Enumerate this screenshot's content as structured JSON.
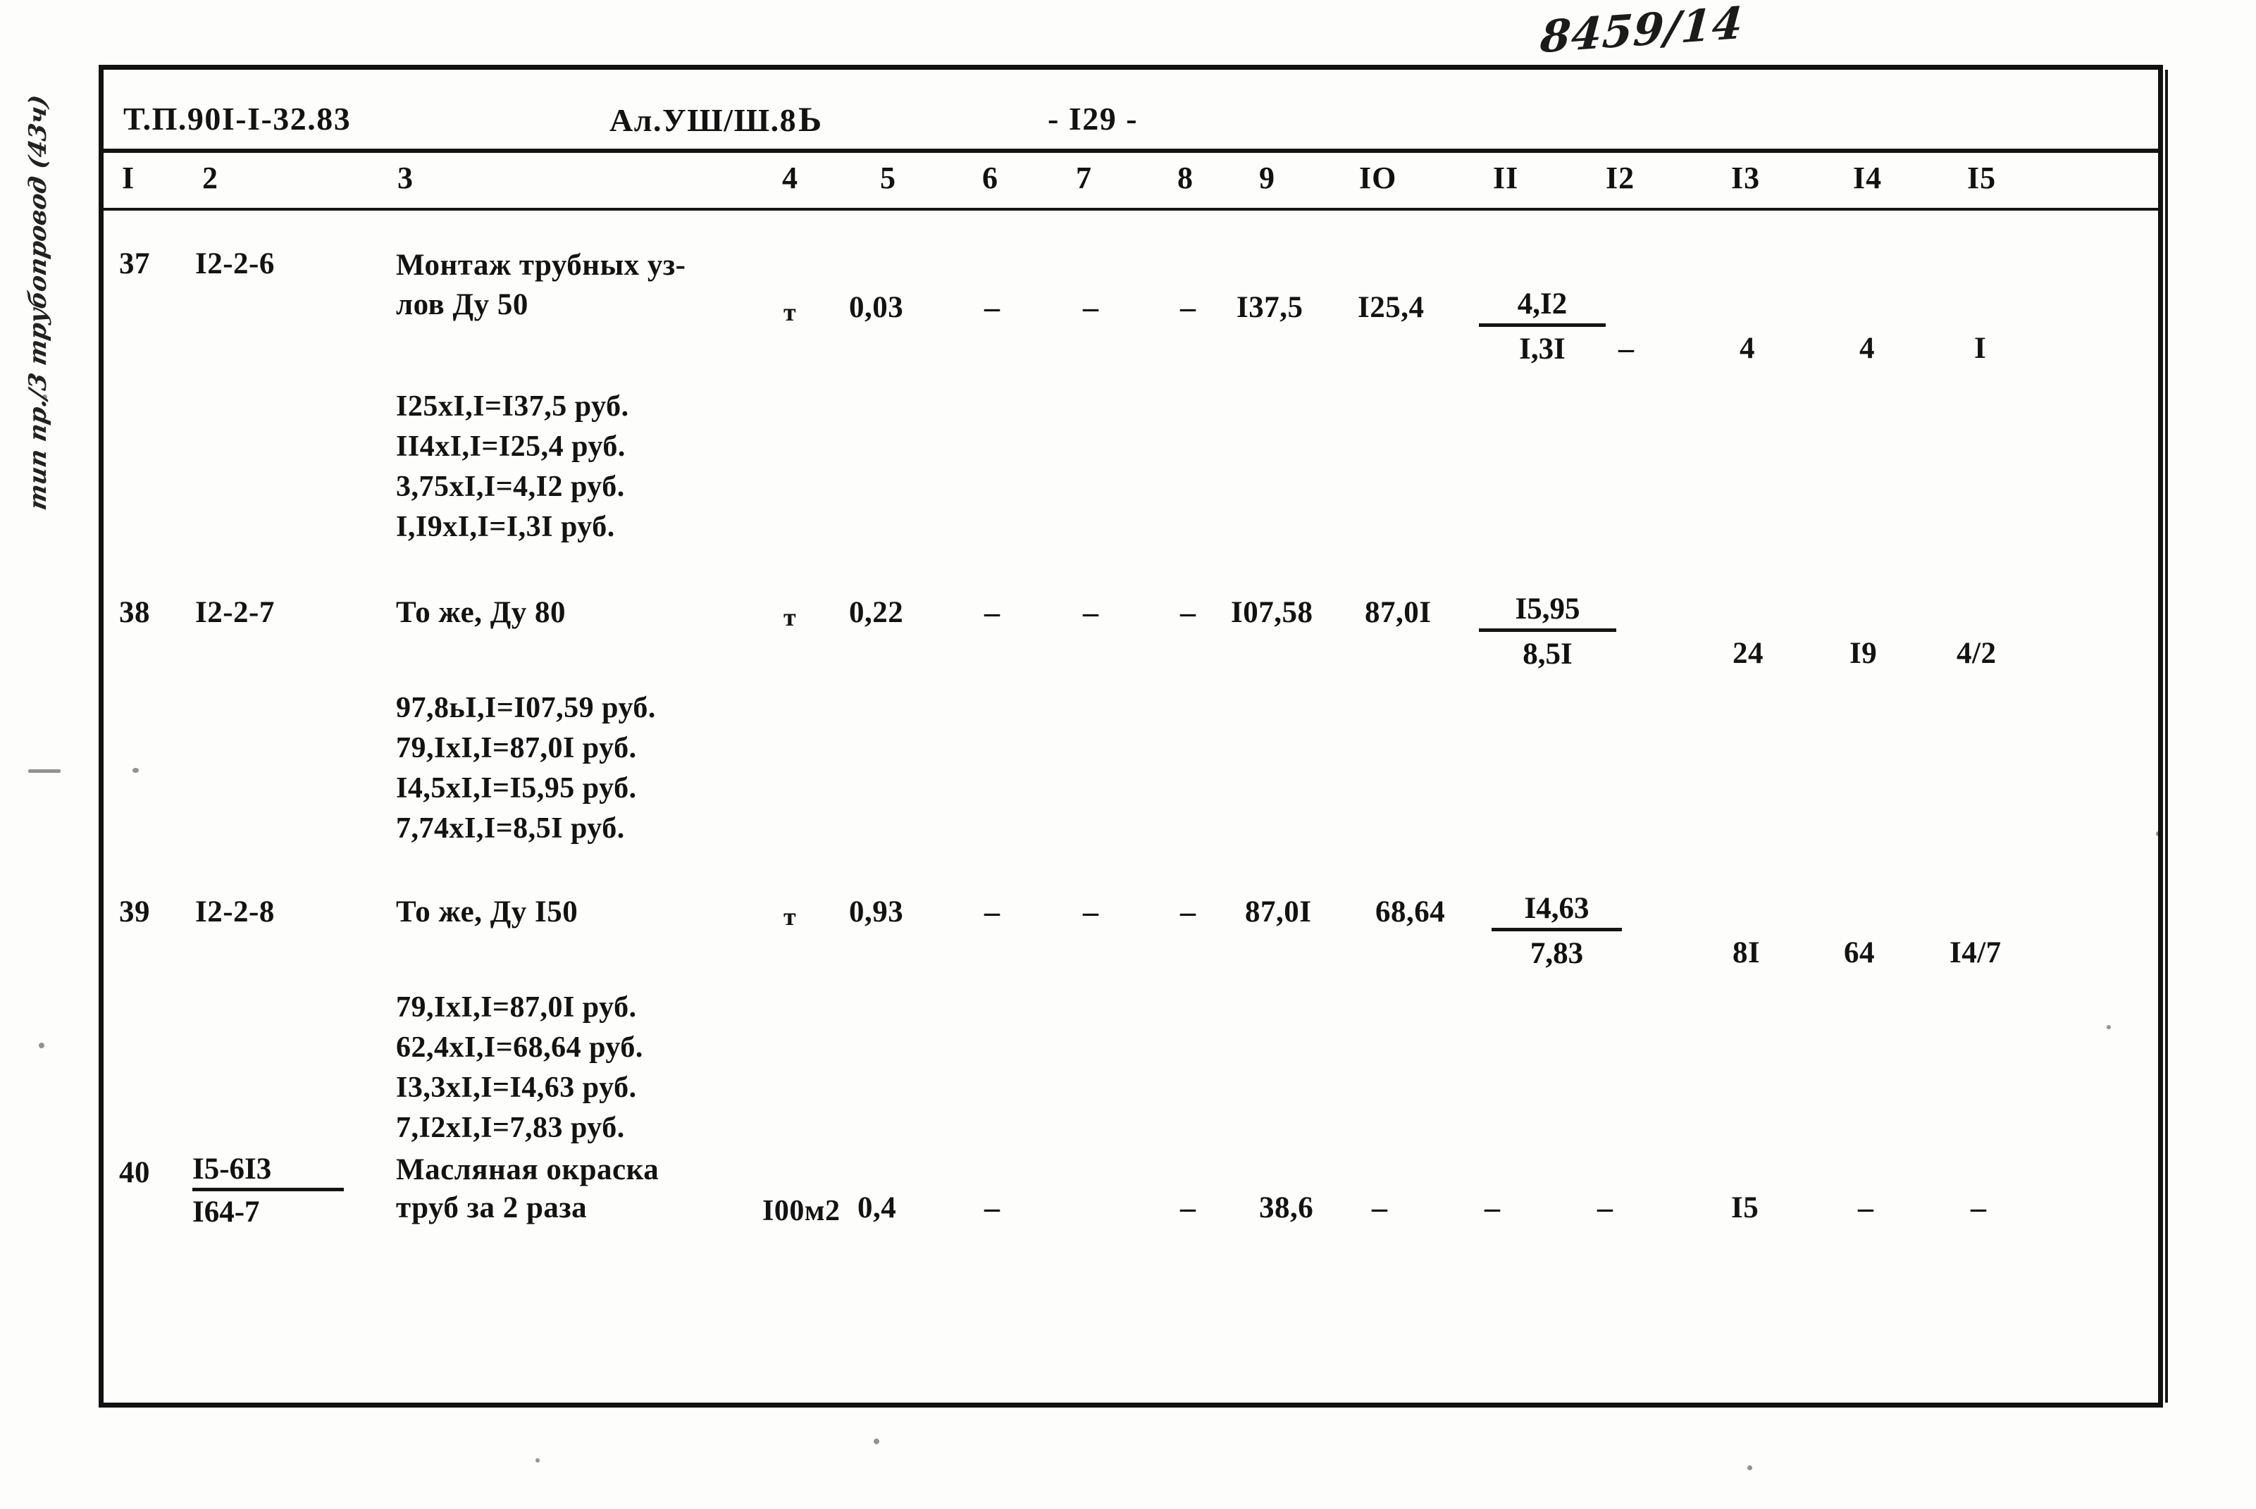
{
  "archive": {
    "handwritten_number": "8459/14",
    "margin_note": "тип пр./3 трубопровод (43ч)"
  },
  "header": {
    "document_code": "Т.П.90I-I-32.83",
    "album": "Ал.УШ/Ш.8",
    "album_stamp": "Ь",
    "page": "- I29 -"
  },
  "column_numbers": [
    "I",
    "2",
    "3",
    "4",
    "5",
    "6",
    "7",
    "8",
    "9",
    "IO",
    "II",
    "I2",
    "I3",
    "I4",
    "I5"
  ],
  "rows": [
    {
      "n": "37",
      "code": "I2-2-6",
      "description_line1": "Монтаж трубных уз-",
      "description_line2": "лов Ду 50",
      "unit": "т",
      "qty": "0,03",
      "c6": "–",
      "c7": "–",
      "c8": "–",
      "c9": "I37,5",
      "c10": "I25,4",
      "c11_num": "4,I2",
      "c11_den": "I,3I",
      "c12": "–",
      "c13": "4",
      "c14": "4",
      "c15": "I",
      "subs": [
        "I25xI,I=I37,5 руб.",
        "II4xI,I=I25,4 руб.",
        "3,75xI,I=4,I2 руб.",
        "I,I9xI,I=I,3I руб."
      ]
    },
    {
      "n": "38",
      "code": "I2-2-7",
      "description_line1": "То же, Ду 80",
      "description_line2": "",
      "unit": "т",
      "qty": "0,22",
      "c6": "–",
      "c7": "–",
      "c8": "–",
      "c9": "I07,58",
      "c10": "87,0I",
      "c11_num": "I5,95",
      "c11_den": "8,5I",
      "c12": "",
      "c13": "24",
      "c14": "I9",
      "c15": "4/2",
      "subs": [
        "97,8ьI,I=I07,59 руб.",
        "79,IxI,I=87,0I руб.",
        "I4,5xI,I=I5,95 руб.",
        "7,74xI,I=8,5I руб."
      ]
    },
    {
      "n": "39",
      "code": "I2-2-8",
      "description_line1": "То же, Ду I50",
      "description_line2": "",
      "unit": "т",
      "qty": "0,93",
      "c6": "–",
      "c7": "–",
      "c8": "–",
      "c9": "87,0I",
      "c10": "68,64",
      "c11_num": "I4,63",
      "c11_den": "7,83",
      "c12": "",
      "c13": "8I",
      "c14": "64",
      "c15": "I4/7",
      "subs": [
        "79,IxI,I=87,0I руб.",
        "62,4xI,I=68,64 руб.",
        "I3,3xI,I=I4,63 руб.",
        "7,I2xI,I=7,83 руб."
      ]
    },
    {
      "n": "40",
      "code_top": "I5-6I3",
      "code_bot": "I64-7",
      "description_line1": "Масляная окраска",
      "description_line2": "труб за 2 раза",
      "unit": "I00м2",
      "qty": "0,4",
      "c6": "–",
      "c7": "",
      "c8": "–",
      "c9": "38,6",
      "c10": "–",
      "c11": "–",
      "c12": "–",
      "c13": "I5",
      "c14": "–",
      "c15": "–",
      "subs": []
    }
  ]
}
